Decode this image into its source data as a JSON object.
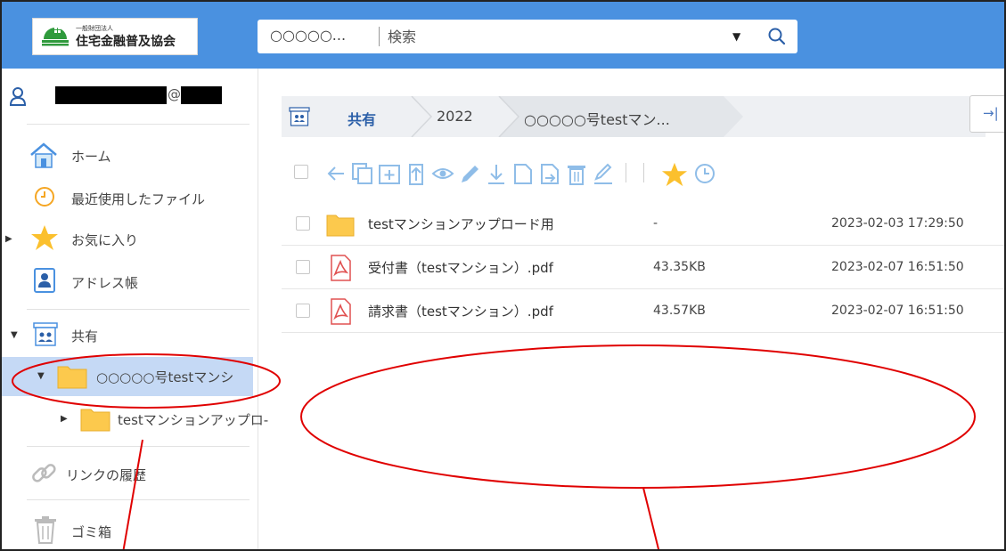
{
  "header": {
    "logo_small": "一般財団法人",
    "logo_text": "住宅金融普及協会",
    "search_scope": "○○○○○...",
    "search_placeholder": "検索"
  },
  "user": {
    "at_sign": "@"
  },
  "sidebar": {
    "home": "ホーム",
    "recent": "最近使用したファイル",
    "favorites": "お気に入り",
    "address_book": "アドレス帳",
    "shared": "共有",
    "tree_root": "○○○○○号testマンシ",
    "tree_child": "testマンションアップロ-",
    "link_history": "リンクの履歴",
    "trash": "ゴミ箱"
  },
  "breadcrumb": {
    "root": "共有",
    "mid": "2022",
    "current": "○○○○○号testマン..."
  },
  "files": [
    {
      "name": "testマンションアップロード用",
      "size": "-",
      "date": "2023-02-03 17:29:50",
      "type": "folder"
    },
    {
      "name": "受付書（testマンション）.pdf",
      "size": "43.35KB",
      "date": "2023-02-07 16:51:50",
      "type": "pdf"
    },
    {
      "name": "請求書（testマンション）.pdf",
      "size": "43.57KB",
      "date": "2023-02-07 16:51:50",
      "type": "pdf"
    }
  ],
  "colors": {
    "header": "#4a91e0",
    "selected": "#c5d9f5",
    "annotation": "#e00000",
    "icon_blue": "#8fbde8"
  }
}
